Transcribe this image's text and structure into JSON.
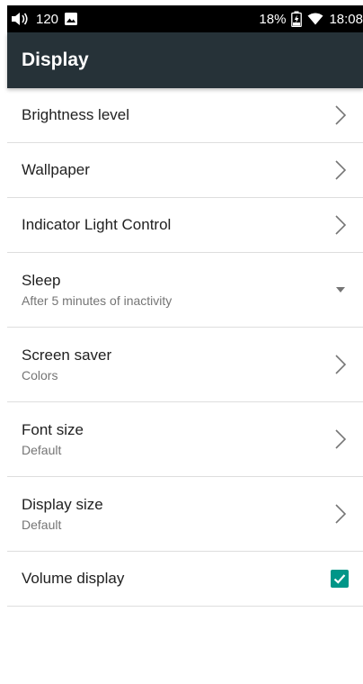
{
  "status_bar": {
    "volume_text": "120",
    "battery": "18%",
    "time": "18:08"
  },
  "app_bar": {
    "title": "Display"
  },
  "settings": {
    "brightness": {
      "title": "Brightness level"
    },
    "wallpaper": {
      "title": "Wallpaper"
    },
    "indicator": {
      "title": "Indicator Light Control"
    },
    "sleep": {
      "title": "Sleep",
      "subtitle": "After 5 minutes of inactivity"
    },
    "screen_saver": {
      "title": "Screen saver",
      "subtitle": "Colors"
    },
    "font_size": {
      "title": "Font size",
      "subtitle": "Default"
    },
    "display_size": {
      "title": "Display size",
      "subtitle": "Default"
    },
    "volume_display": {
      "title": "Volume display",
      "checked": true
    }
  },
  "colors": {
    "app_bar": "#263238",
    "accent": "#009688",
    "status_bar": "#000000"
  },
  "icons": {
    "status": [
      "volume-icon",
      "image-icon",
      "battery-charging-icon",
      "wifi-icon"
    ],
    "row_action": "chevron-right-icon",
    "dropdown": "dropdown-arrow-icon",
    "checkbox": "checkbox-checked-icon"
  }
}
